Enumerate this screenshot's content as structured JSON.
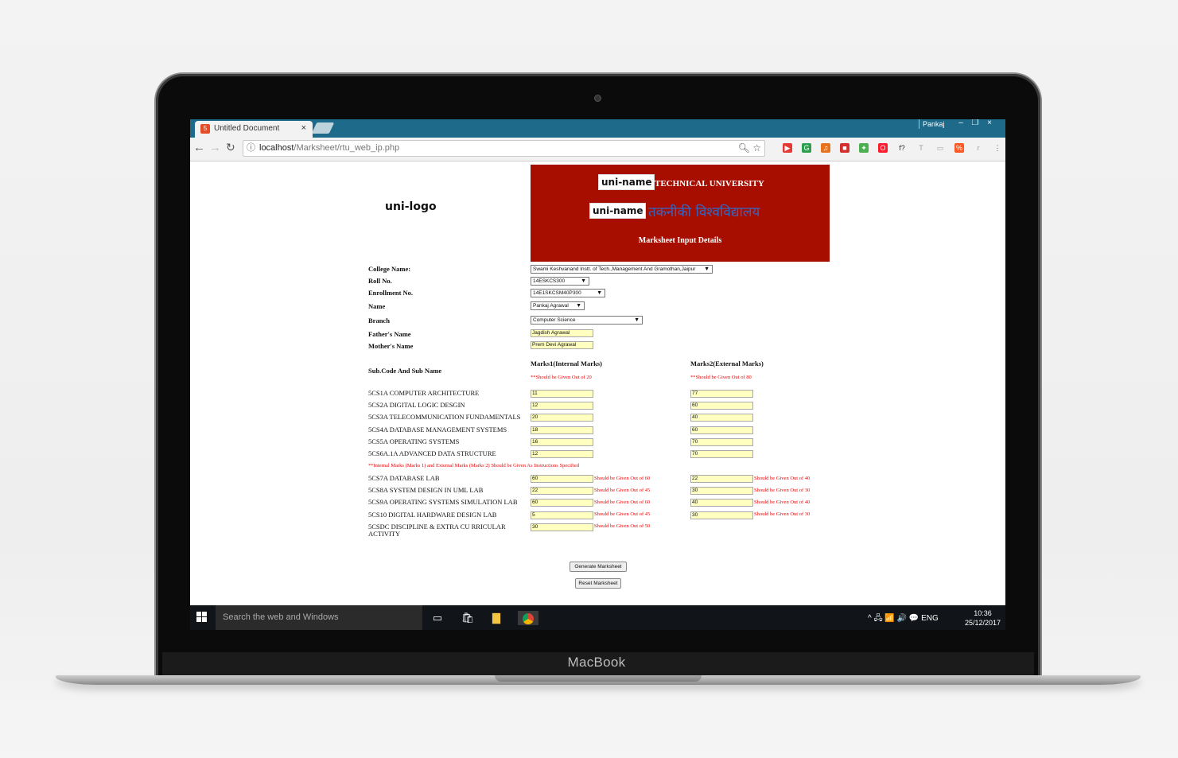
{
  "device": {
    "brand": "MacBook"
  },
  "browser": {
    "tab_title": "Untitled Document",
    "tab_close": "×",
    "window_user": "Pankaj",
    "window_buttons": [
      "–",
      "❐",
      "×"
    ],
    "url_host": "localhost",
    "url_path": "/Marksheet/rtu_web_ip.php",
    "extensions": [
      {
        "label": "▶",
        "color": "#e53935"
      },
      {
        "label": "G",
        "color": "#2e9e4f"
      },
      {
        "label": "♫",
        "color": "#e8711c"
      },
      {
        "label": "■",
        "color": "#d32f2f"
      },
      {
        "label": "✦",
        "color": "#4caf50"
      },
      {
        "label": "O",
        "color": "#ff1b2d"
      },
      {
        "label": "f?",
        "color": "#333333"
      },
      {
        "label": "T",
        "color": "#9e9e9e"
      },
      {
        "label": "▭",
        "color": "#9e9e9e"
      },
      {
        "label": "%",
        "color": "#ff5722"
      },
      {
        "label": "r",
        "color": "#9e9e9e"
      },
      {
        "label": "⋮",
        "color": "#555555"
      }
    ]
  },
  "page": {
    "logo_placeholder": "uni-logo",
    "banner": {
      "uni_name_1": "uni-name",
      "english": "TECHNICAL UNIVERSITY",
      "uni_name_2": "uni-name",
      "hindi": "तकनीकी विश्वविद्यालय",
      "subtitle": "Marksheet Input Details",
      "color": "#a80e00"
    },
    "fields": {
      "college_label": "College Name:",
      "college_value": "Swami Keshvanand Instt. of Tech.,Management And Gramothan,Jaipur",
      "roll_label": "Roll No.",
      "roll_value": "14ESKCS300",
      "enroll_label": "Enrollment No.",
      "enroll_value": "14E1SKCSM40P300",
      "name_label": "Name",
      "name_value": "Pankaj Agrawal",
      "branch_label": "Branch",
      "branch_value": "Computer Science",
      "father_label": "Father's Name",
      "father_value": "Jagdish Agrawal",
      "mother_label": "Mother's Name",
      "mother_value": "Prem Devi Agrawal"
    },
    "marks_header": {
      "sub_label": "Sub.Code And Sub Name",
      "m1_label": "Marks1(Internal Marks)",
      "m1_note": "**Should be Given Out of 20",
      "m2_label": "Marks2(External Marks)",
      "m2_note": "**Should be Given Out of 80"
    },
    "theory": [
      {
        "name": "5CS1A COMPUTER ARCHITECTURE",
        "m1": "11",
        "m2": "77"
      },
      {
        "name": "5CS2A DIGITAL LOGIC DESGIN",
        "m1": "12",
        "m2": "60"
      },
      {
        "name": "5CS3A TELECOMMUNICATION FUNDAMENTALS",
        "m1": "20",
        "m2": "40"
      },
      {
        "name": "5CS4A DATABASE MANAGEMENT SYSTEMS",
        "m1": "18",
        "m2": "60"
      },
      {
        "name": "5CS5A OPERATING SYSTEMS",
        "m1": "16",
        "m2": "70"
      },
      {
        "name": "5CS6A.1A ADVANCED DATA STRUCTURE",
        "m1": "12",
        "m2": "70"
      }
    ],
    "instruction": "**Internal Marks (Marks 1) and External Marks (Marks 2) Should be Given As Instructions Specified",
    "labs": [
      {
        "name": "5CS7A DATABASE LAB",
        "m1": "60",
        "n1": "Should be Given Out of 60",
        "m2": "22",
        "n2": "Should be Given Out of 40"
      },
      {
        "name": "5CS8A SYSTEM DESIGN IN UML LAB",
        "m1": "22",
        "n1": "Should be Given Out of 45",
        "m2": "30",
        "n2": "Should be Given Out of 30"
      },
      {
        "name": "5CS9A OPERATING SYSTEMS SIMULATION LAB",
        "m1": "60",
        "n1": "Should be Given Out of 60",
        "m2": "40",
        "n2": "Should be Given Out of 40"
      },
      {
        "name": "5CS10 DIGITAL HARDWARE DESIGN LAB",
        "m1": "5",
        "n1": "Should be Given Out of 45",
        "m2": "30",
        "n2": "Should be Given Out of 30"
      },
      {
        "name": "5CSDC DISCIPLINE & EXTRA CU RRICULAR ACTIVITY",
        "m1": "30",
        "n1": "Should be Given Out of 50",
        "m2": null,
        "n2": null
      }
    ],
    "buttons": {
      "generate": "Generate Marksheet",
      "reset": "Reset Marksheet"
    }
  },
  "taskbar": {
    "search_placeholder": "Search the web and Windows",
    "tray_text": "^  🖧  📶  🔊  💬  ENG",
    "time": "10:36",
    "date": "25/12/2017"
  }
}
